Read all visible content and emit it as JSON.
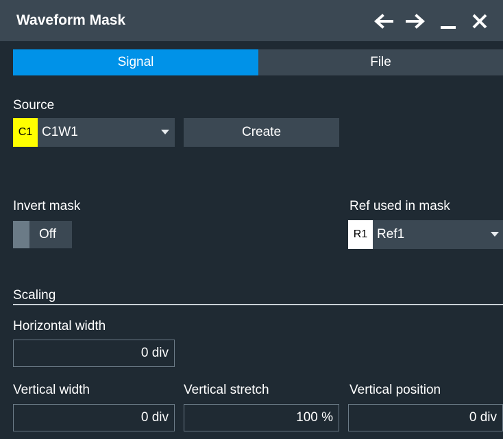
{
  "window": {
    "title": "Waveform Mask",
    "icons": [
      "arrow-left-icon",
      "arrow-right-icon",
      "minimize-icon",
      "close-icon"
    ]
  },
  "tabs": [
    {
      "label": "Signal",
      "active": true
    },
    {
      "label": "File",
      "active": false
    }
  ],
  "source": {
    "label": "Source",
    "badge": "C1",
    "badge_color": "#ffff00",
    "value": "C1W1",
    "create_label": "Create"
  },
  "invert_mask": {
    "label": "Invert mask",
    "value": "Off"
  },
  "ref": {
    "label": "Ref used in mask",
    "badge": "R1",
    "badge_color": "#ffffff",
    "value": "Ref1"
  },
  "scaling": {
    "label": "Scaling",
    "horizontal_width": {
      "label": "Horizontal width",
      "value": "0 div"
    },
    "vertical_width": {
      "label": "Vertical width",
      "value": "0 div"
    },
    "vertical_stretch": {
      "label": "Vertical stretch",
      "value": "100 %"
    },
    "vertical_position": {
      "label": "Vertical position",
      "value": "0 div"
    }
  },
  "colors": {
    "accent": "#0092e8",
    "panel": "#3b4853",
    "background": "#1f2a33"
  }
}
